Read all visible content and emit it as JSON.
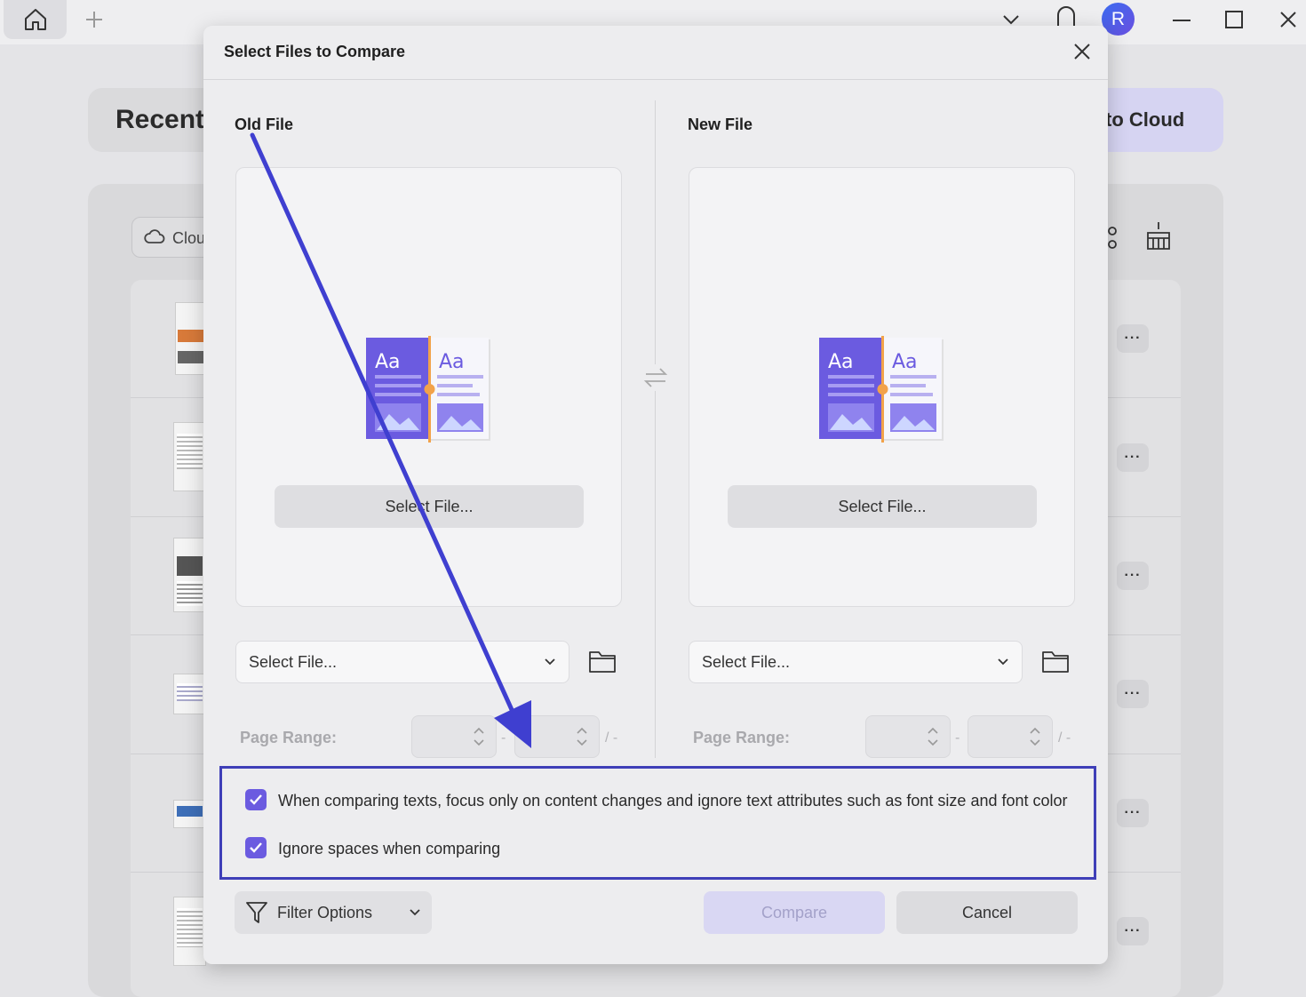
{
  "titlebar": {
    "icons": [
      "home-icon",
      "plus-icon",
      "chevron-down-icon",
      "bell-icon",
      "minimize-icon",
      "maximize-icon",
      "close-icon"
    ],
    "avatar_initial": "R"
  },
  "background": {
    "recent_title": "Recent",
    "cloud_button_label": "to Cloud",
    "cloud_filter_label": "Clou",
    "row_actions_label": "···"
  },
  "dialog": {
    "title": "Select Files to Compare",
    "old_file": {
      "label": "Old File",
      "select_button": "Select File...",
      "dropdown_value": "Select File...",
      "page_range_label": "Page Range:",
      "page_range_sep": "-",
      "page_range_total": "/ -"
    },
    "new_file": {
      "label": "New File",
      "select_button": "Select File...",
      "dropdown_value": "Select File...",
      "page_range_label": "Page Range:",
      "page_range_sep": "-",
      "page_range_total": "/ -"
    },
    "options": [
      {
        "label": "When comparing texts, focus only on content changes and ignore text attributes such as font size and font color",
        "checked": true
      },
      {
        "label": "Ignore spaces when comparing",
        "checked": true
      }
    ],
    "filter_button": "Filter Options",
    "compare_button": "Compare",
    "cancel_button": "Cancel"
  },
  "colors": {
    "accent": "#6b5be0",
    "annotation": "#3f3fb8",
    "dialog_bg": "#ededef"
  }
}
